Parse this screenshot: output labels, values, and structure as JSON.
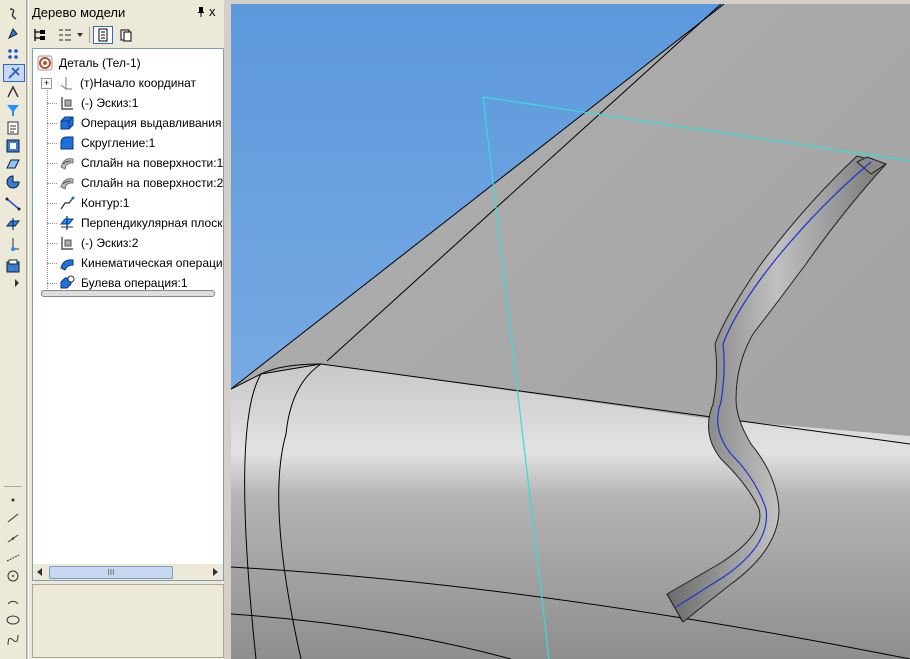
{
  "panel": {
    "title": "Дерево модели",
    "pin_icon": "pin-icon",
    "close_label": "x"
  },
  "tree": {
    "root": {
      "label": "Деталь (Тел-1)",
      "icon": "part-icon"
    },
    "items": [
      {
        "label": "(т)Начало координат",
        "icon": "origin-icon",
        "expander": "+"
      },
      {
        "label": "(-) Эскиз:1",
        "icon": "sketch-icon"
      },
      {
        "label": "Операция выдавливания",
        "icon": "extrude-icon"
      },
      {
        "label": "Скругление:1",
        "icon": "fillet-icon"
      },
      {
        "label": "Сплайн на поверхности:1",
        "icon": "surface-spline-icon"
      },
      {
        "label": "Сплайн на поверхности:2",
        "icon": "surface-spline-icon"
      },
      {
        "label": "Контур:1",
        "icon": "contour-icon"
      },
      {
        "label": "Перпендикулярная плоск",
        "icon": "perpendicular-plane-icon"
      },
      {
        "label": "(-) Эскиз:2",
        "icon": "sketch-icon"
      },
      {
        "label": "Кинематическая операци",
        "icon": "sweep-icon"
      },
      {
        "label": "Булева операция:1",
        "icon": "boolean-icon"
      }
    ]
  },
  "scroll": {
    "grip": "III"
  },
  "colors": {
    "sky": "#6ea3df",
    "solid": "#a8a8a8",
    "plane_outline": "#33dddd",
    "path_line": "#2233cc",
    "panel_bg": "#ece9d8"
  }
}
